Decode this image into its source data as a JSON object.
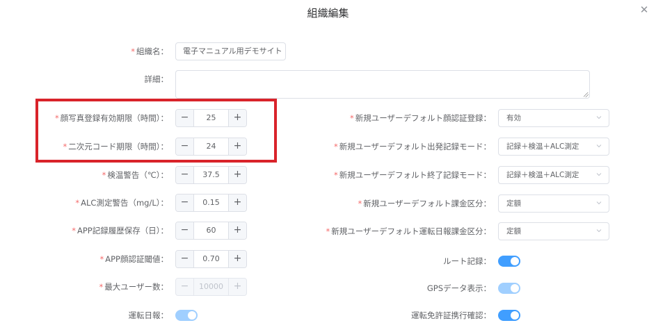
{
  "dialog": {
    "title": "組織編集"
  },
  "form": {
    "org_name": {
      "label": "組織名：",
      "value": "電子マニュアル用デモサイト"
    },
    "detail": {
      "label": "詳細："
    },
    "face_photo_period": {
      "label": "顔写真登録有効期限（時間）：",
      "value": "25"
    },
    "qr_period": {
      "label": "二次元コード期限（時間）：",
      "value": "24"
    },
    "temp_warning": {
      "label": "検温警告（℃）：",
      "value": "37.5"
    },
    "alc_warning": {
      "label": "ALC測定警告（mg/L）：",
      "value": "0.15"
    },
    "app_log_retention": {
      "label": "APP記録履歴保存（日）：",
      "value": "60"
    },
    "app_face_threshold": {
      "label": "APP顔認証閾値：",
      "value": "0.70"
    },
    "max_users": {
      "label": "最大ユーザー数：",
      "value": "10000"
    },
    "driving_daily_report": {
      "label": "運転日報："
    },
    "default_face_auth": {
      "label": "新規ユーザーデフォルト顔認証登録：",
      "value": "有効"
    },
    "default_departure_mode": {
      "label": "新規ユーザーデフォルト出発記録モード：",
      "value": "記録＋検温＋ALC測定"
    },
    "default_end_mode": {
      "label": "新規ユーザーデフォルト終了記録モード：",
      "value": "記録＋検温＋ALC測定"
    },
    "default_billing": {
      "label": "新規ユーザーデフォルト課金区分：",
      "value": "定額"
    },
    "default_report_billing": {
      "label": "新規ユーザーデフォルト運転日報課金区分：",
      "value": "定額"
    },
    "route_record": {
      "label": "ルート記録："
    },
    "gps_display": {
      "label": "GPSデータ表示："
    },
    "license_check": {
      "label": "運転免許証携行確認："
    }
  },
  "stepper": {
    "minus": "−",
    "plus": "+"
  },
  "required_mark": "*",
  "icons": {
    "close": "close-icon",
    "chevron": "chevron-down-icon"
  },
  "colors": {
    "accent": "#409eff",
    "required": "#f56c6c",
    "highlight": "#d9232a"
  }
}
